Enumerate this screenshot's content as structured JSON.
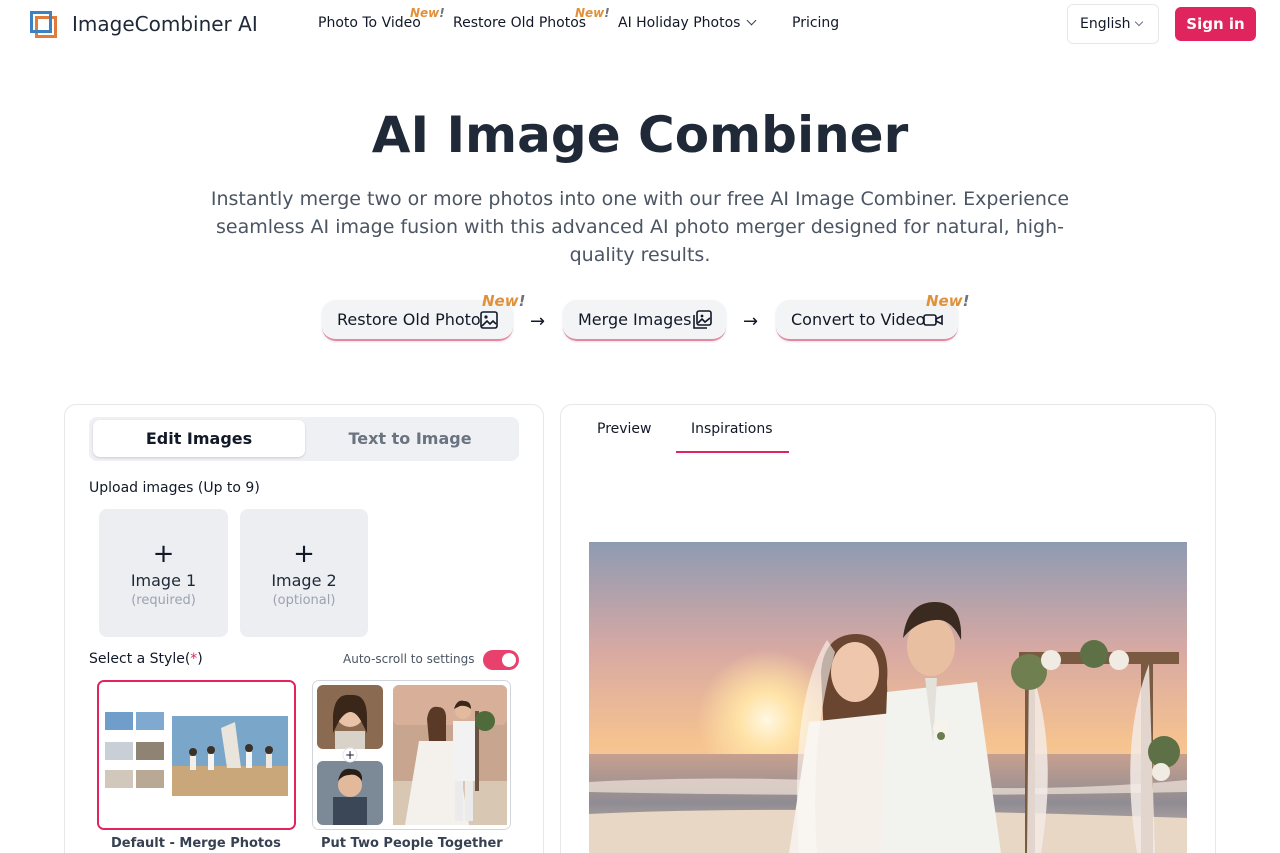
{
  "nav": {
    "brand": "ImageCombiner AI",
    "links": [
      "Photo To Video",
      "Restore Old Photos",
      "AI Holiday Photos",
      "Pricing"
    ],
    "new_badge": "New",
    "new_bang": "!",
    "language": "English",
    "signin": "Sign in"
  },
  "hero": {
    "title": "AI Image Combiner",
    "subtitle": "Instantly merge two or more photos into one with our free AI Image Combiner. Experience seamless AI image fusion with this advanced AI photo merger designed for natural, high-quality results."
  },
  "steps": [
    "Restore Old Photo",
    "Merge Images",
    "Convert to Video"
  ],
  "editor": {
    "tabs": [
      "Edit Images",
      "Text to Image"
    ],
    "upload_label": "Upload images (Up to 9)",
    "upload_slots": [
      {
        "label": "Image 1",
        "hint": "(required)"
      },
      {
        "label": "Image 2",
        "hint": "(optional)"
      }
    ],
    "style_label": "Select a Style(",
    "style_star": "*",
    "style_close": ")",
    "autoscroll_label": "Auto-scroll to settings",
    "autoscroll_on": true,
    "styles": [
      "Default - Merge Photos",
      "Put Two People Together"
    ]
  },
  "preview": {
    "tabs": [
      "Preview",
      "Inspirations"
    ],
    "active_tab": "Inspirations"
  },
  "colors": {
    "accent": "#e0245e",
    "badge": "#e0913a"
  }
}
